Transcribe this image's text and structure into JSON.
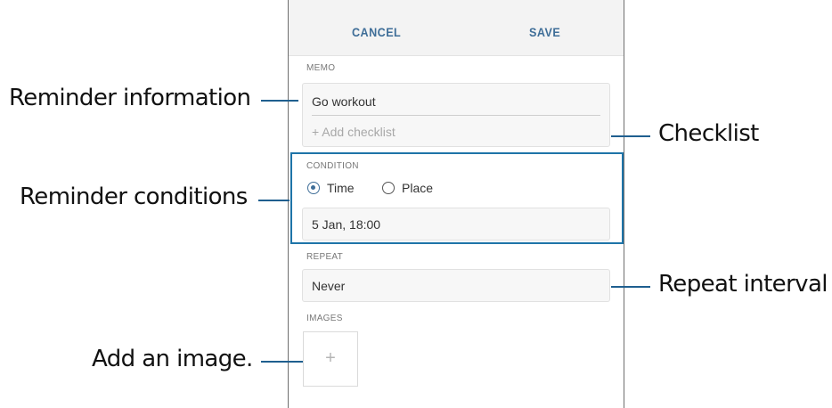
{
  "toolbar": {
    "cancel_label": "CANCEL",
    "save_label": "SAVE"
  },
  "memo": {
    "label": "MEMO",
    "value": "Go workout",
    "add_checklist": "+ Add checklist"
  },
  "condition": {
    "label": "CONDITION",
    "options": [
      {
        "label": "Time",
        "selected": true
      },
      {
        "label": "Place",
        "selected": false
      }
    ],
    "datetime": "5 Jan, 18:00"
  },
  "repeat": {
    "label": "REPEAT",
    "value": "Never"
  },
  "images": {
    "label": "IMAGES",
    "add_symbol": "+"
  },
  "annotations": {
    "reminder_information": "Reminder information",
    "reminder_conditions": "Reminder conditions",
    "add_image": "Add an image.",
    "checklist": "Checklist",
    "repeat_interval": "Repeat interval"
  },
  "colors": {
    "accent": "#3f6e98",
    "highlight_frame": "#1e74a8",
    "leader_line": "#1f5f8f"
  }
}
